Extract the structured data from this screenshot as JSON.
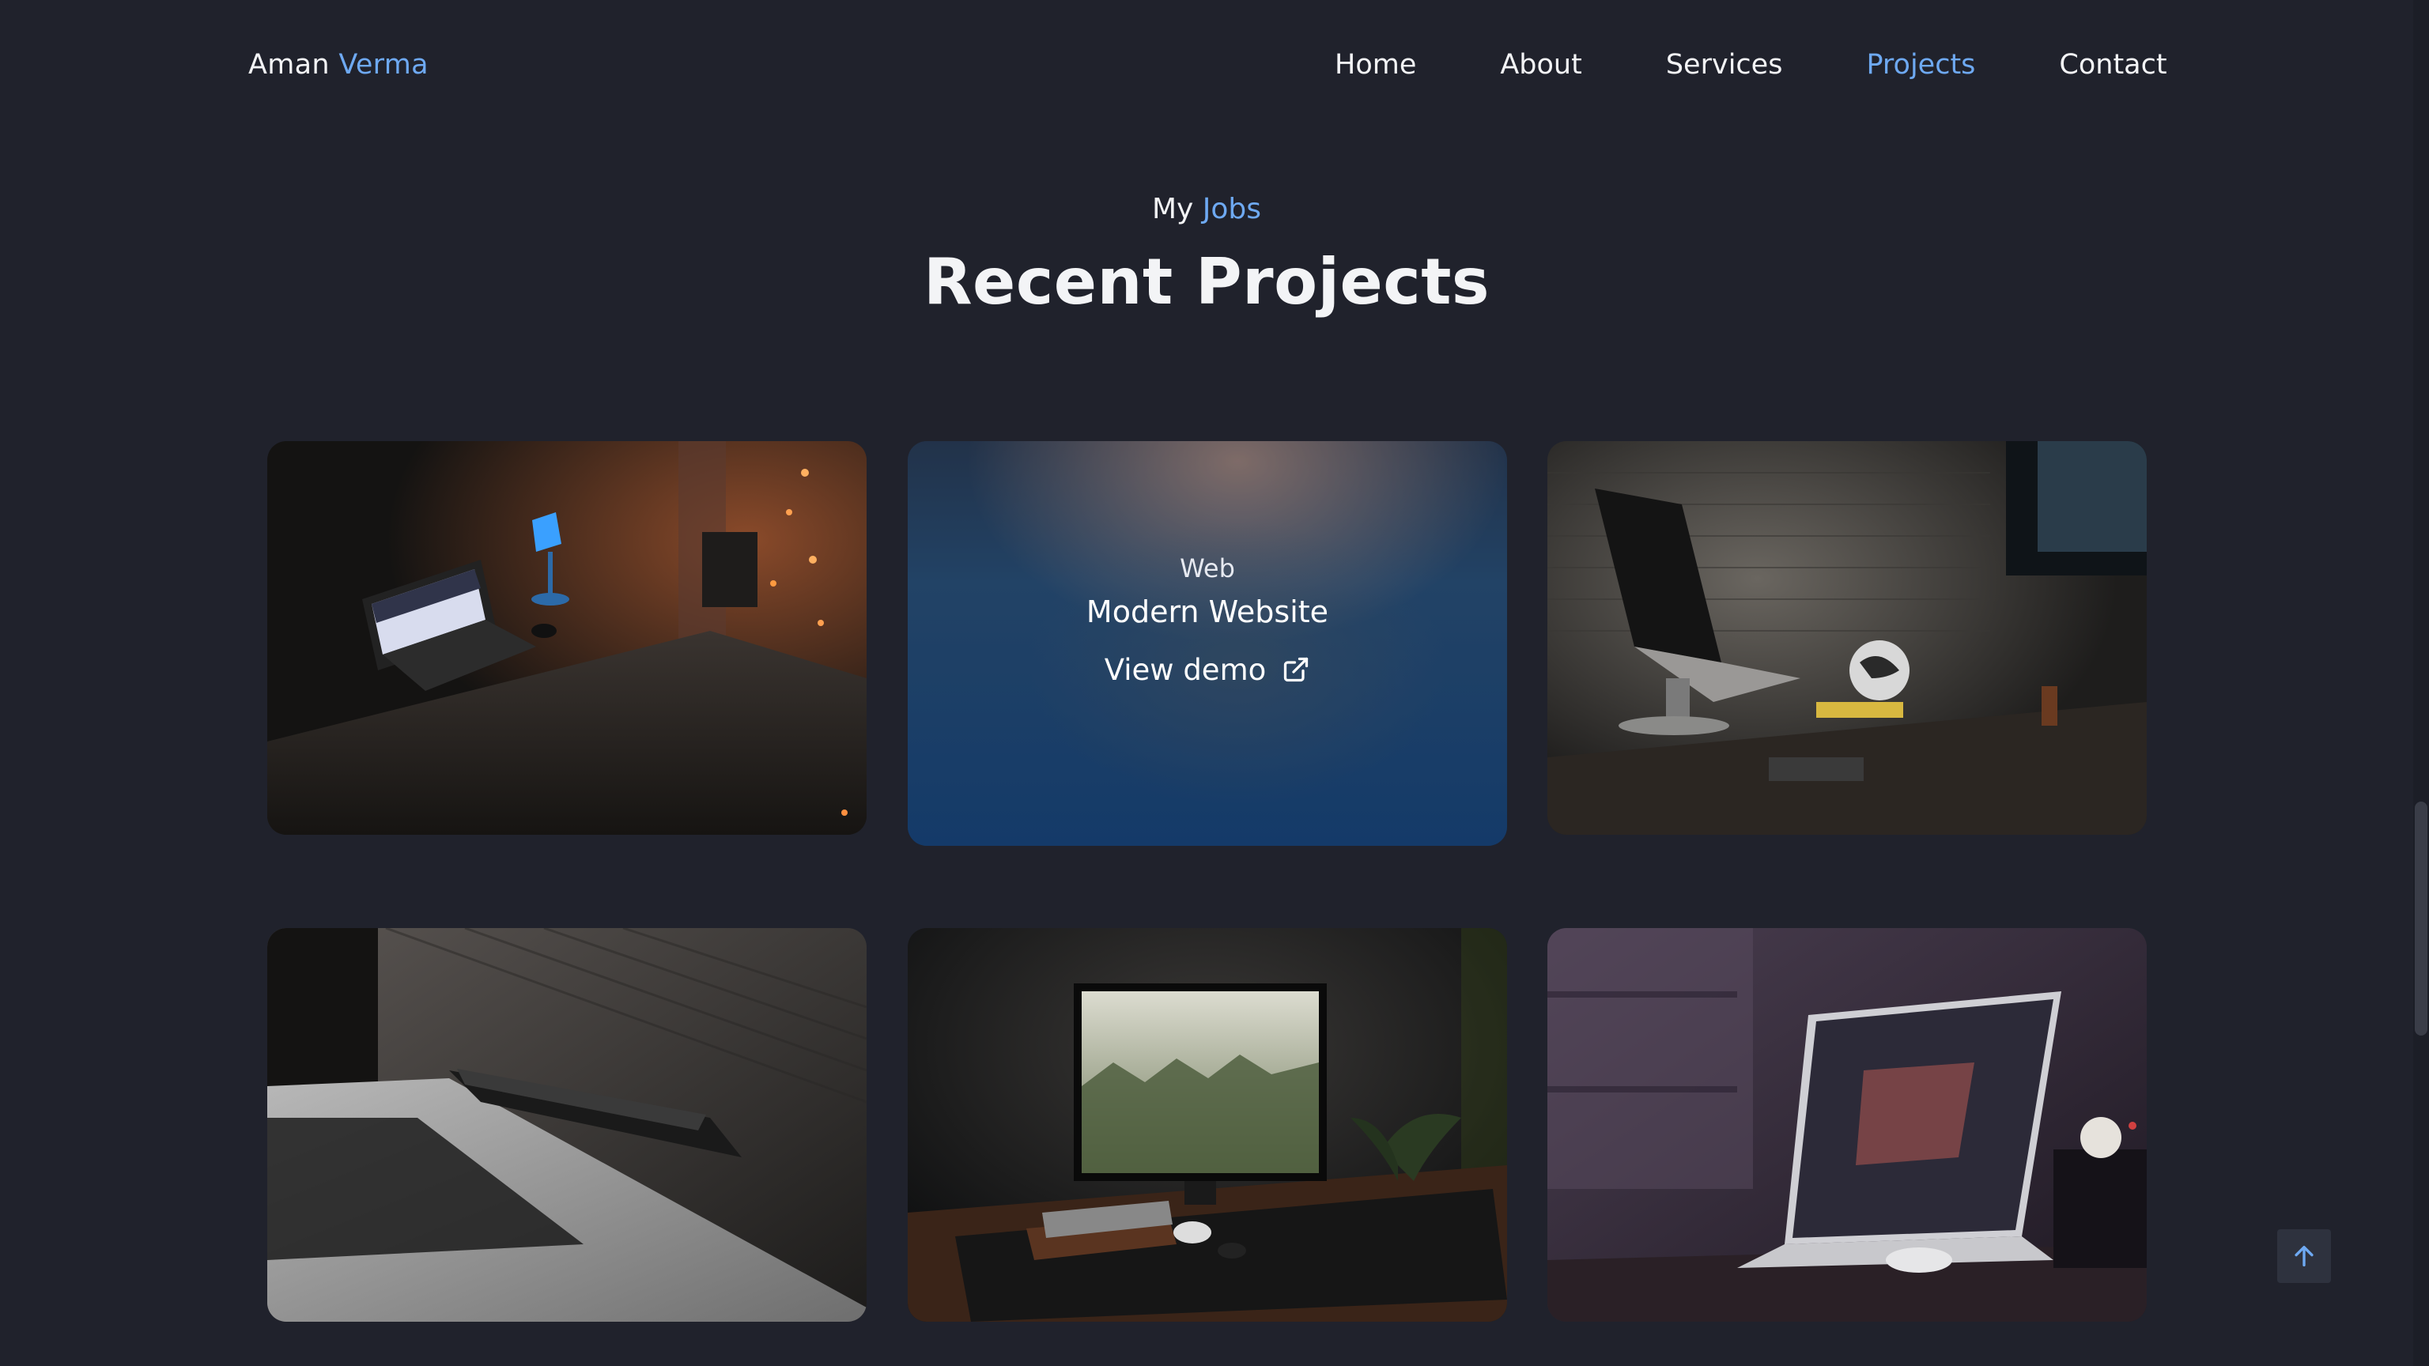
{
  "header": {
    "logo_first": "Aman",
    "logo_last": "Verma",
    "nav": [
      {
        "label": "Home"
      },
      {
        "label": "About"
      },
      {
        "label": "Services"
      },
      {
        "label": "Projects",
        "active": true
      },
      {
        "label": "Contact"
      }
    ]
  },
  "section": {
    "subtitle_prefix": "My",
    "subtitle_accent": "Jobs",
    "title": "Recent Projects"
  },
  "projects": [
    {
      "image": "dark desk with laptop, blue lamp and string lights"
    },
    {
      "image": "blurred blue desk",
      "category": "Web",
      "name": "Modern Website",
      "link_label": "View demo",
      "link_icon": "external-link-icon"
    },
    {
      "image": "laptop on stand by brick wall with globe"
    },
    {
      "image": "laptop and smartphone on wood table"
    },
    {
      "image": "monitor with forest wallpaper and keyboard"
    },
    {
      "image": "laptop on desk in purple light with mouse"
    }
  ],
  "controls": {
    "back_to_top_icon": "arrow-up-icon"
  },
  "colors": {
    "background": "#20222c",
    "accent": "#6ea9f2",
    "text": "#f3f4f6"
  }
}
